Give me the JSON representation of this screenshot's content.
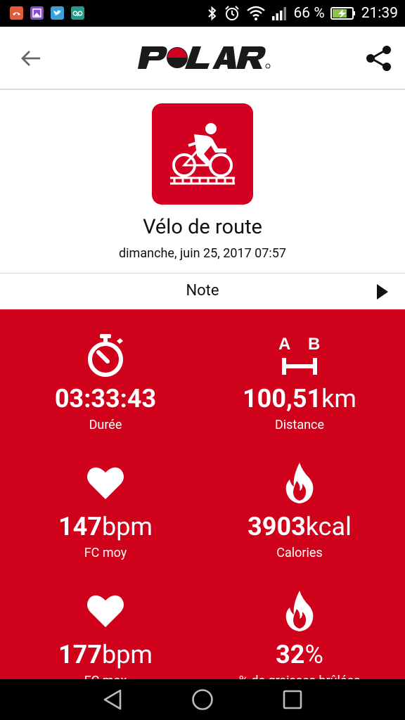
{
  "status_bar": {
    "battery_percent": "66 %",
    "time": "21:39",
    "notification_icons": [
      "missed-call-icon",
      "gallery-icon",
      "twitter-icon",
      "voicemail-icon"
    ]
  },
  "header": {
    "logo_text": "POLAR",
    "back_icon": "arrow-left-icon",
    "share_icon": "share-icon"
  },
  "summary": {
    "sport_icon": "road-bike-icon",
    "sport_name": "Vélo de route",
    "date": "dimanche, juin 25, 2017 07:57"
  },
  "note": {
    "label": "Note"
  },
  "stats": [
    {
      "icon": "stopwatch-icon",
      "value": "03:33:43",
      "unit": "",
      "label": "Durée"
    },
    {
      "icon": "distance-ab-icon",
      "value": "100,51",
      "unit": "km",
      "label": "Distance"
    },
    {
      "icon": "heart-icon",
      "value": "147",
      "unit": "bpm",
      "label": "FC moy"
    },
    {
      "icon": "flame-icon",
      "value": "3903",
      "unit": "kcal",
      "label": "Calories"
    },
    {
      "icon": "heart-icon",
      "value": "177",
      "unit": "bpm",
      "label": "FC max"
    },
    {
      "icon": "flame-icon",
      "value": "32",
      "unit": "%",
      "label": "% de graisses brûlées"
    }
  ],
  "colors": {
    "brand_red": "#d0021b",
    "icon_red": "#d40021"
  }
}
